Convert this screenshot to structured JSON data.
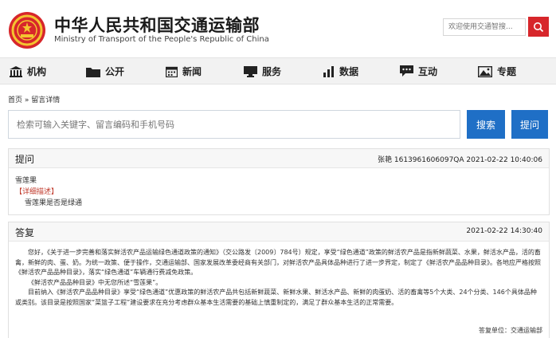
{
  "header": {
    "title_cn": "中华人民共和国交通运输部",
    "title_en": "Ministry of Transport of the People's Republic of China",
    "search_placeholder": "欢迎使用交通智搜...",
    "emblem_icon": "national-emblem-icon"
  },
  "nav": {
    "items": [
      {
        "label": "机构",
        "icon": "building-icon"
      },
      {
        "label": "公开",
        "icon": "folder-icon"
      },
      {
        "label": "新闻",
        "icon": "calendar-icon"
      },
      {
        "label": "服务",
        "icon": "monitor-icon"
      },
      {
        "label": "数据",
        "icon": "bar-chart-icon"
      },
      {
        "label": "互动",
        "icon": "chat-icon"
      },
      {
        "label": "专题",
        "icon": "image-icon"
      }
    ]
  },
  "breadcrumb": "首页 » 留言详情",
  "main_search": {
    "placeholder": "检索可输入关键字、留言编码和手机号码",
    "search_label": "搜索",
    "ask_label": "提问"
  },
  "question": {
    "heading": "提问",
    "meta": "张艳 1613961606097QA  2021-02-22 10:40:06",
    "subject": "雪莲果",
    "detail_label": "【详细描述】",
    "detail": "雪莲果是否是绿通"
  },
  "answer": {
    "heading": "答复",
    "date": "2021-02-22 14:30:40",
    "paragraphs": [
      "您好，《关于进一步完善和落实鲜活农产品运输绿色通道政策的通知》（交公路发〔2009〕784号）规定，享受“绿色通道”政策的鲜活农产品是指新鲜蔬菜、水果，鲜活水产品，活的畜禽，新鲜的肉、蛋、奶。为统一政策、便于操作，交通运输部、国家发展改革委经商有关部门，对鲜活农产品具体品种进行了进一步界定，制定了《鲜活农产品品种目录》。各地应严格按照《鲜活农产品品种目录》，落实“绿色通道”车辆通行费减免政策。",
      "《鲜活农产品品种目录》中无您所述“雪莲果”。",
      "目前纳入《鲜活农产品品种目录》享受“绿色通道”优惠政策的鲜活农产品共包括新鲜蔬菜、新鲜水果、鲜活水产品、新鲜的肉蛋奶、活的畜禽等5个大类、24个分类、146个具体品种或类别。该目录是按照国家“菜篮子工程”建设要求在充分考虑群众基本生活需要的基础上慎重制定的，满足了群众基本生活的正常需要。"
    ],
    "unit": "答复单位：交通运输部"
  },
  "colors": {
    "accent_blue": "#1f6fc6",
    "brand_red": "#d7262b"
  }
}
